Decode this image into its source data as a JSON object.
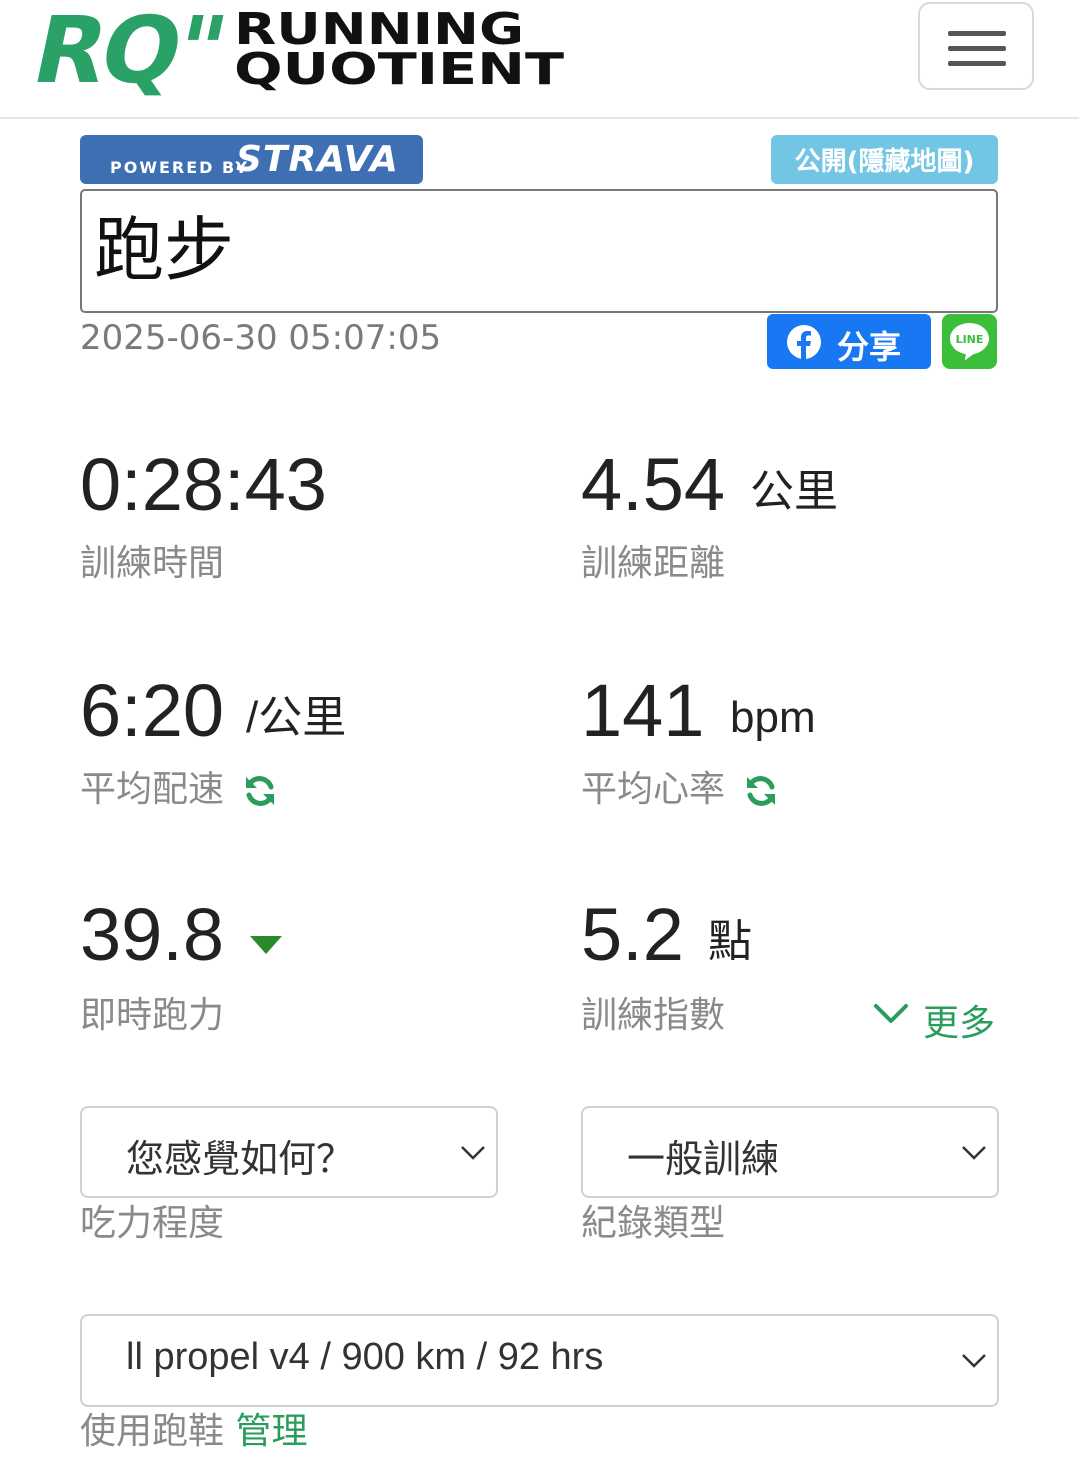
{
  "header": {
    "logo_mark": "RQ\"",
    "logo_line1": "RUNNING",
    "logo_line2": "QUOTIENT",
    "menu_icon": "hamburger-icon"
  },
  "activity": {
    "powered_by": "POWERED BY",
    "strava_brand": "STRAVA",
    "privacy_badge": "公開(隱藏地圖)",
    "title": "跑步",
    "datetime": "2025-06-30 05:07:05",
    "share_label": "分享",
    "line_label": "LINE"
  },
  "stats": {
    "duration": {
      "value": "0:28:43",
      "label": "訓練時間"
    },
    "distance": {
      "value": "4.54",
      "unit": "公里",
      "label": "訓練距離"
    },
    "pace": {
      "value": "6:20",
      "unit": "/公里",
      "label": "平均配速"
    },
    "heart_rate": {
      "value": "141",
      "unit": "bpm",
      "label": "平均心率"
    },
    "running_power": {
      "value": "39.8",
      "label": "即時跑力"
    },
    "training_index": {
      "value": "5.2",
      "unit": "點",
      "label": "訓練指數"
    },
    "more_label": "更多"
  },
  "forms": {
    "effort": {
      "selected": "您感覺如何？",
      "label": "吃力程度"
    },
    "record_type": {
      "selected": "一般訓練",
      "label": "紀錄類型"
    },
    "shoes": {
      "selected": "ll propel v4 / 900 km / 92 hrs",
      "label": "使用跑鞋",
      "manage_link": "管理"
    }
  },
  "colors": {
    "brand_green": "#2a9d5c",
    "strava_blue": "#3f6fb3",
    "privacy_blue": "#73c6e3",
    "facebook_blue": "#1877f2",
    "line_green": "#3bbf3b"
  }
}
